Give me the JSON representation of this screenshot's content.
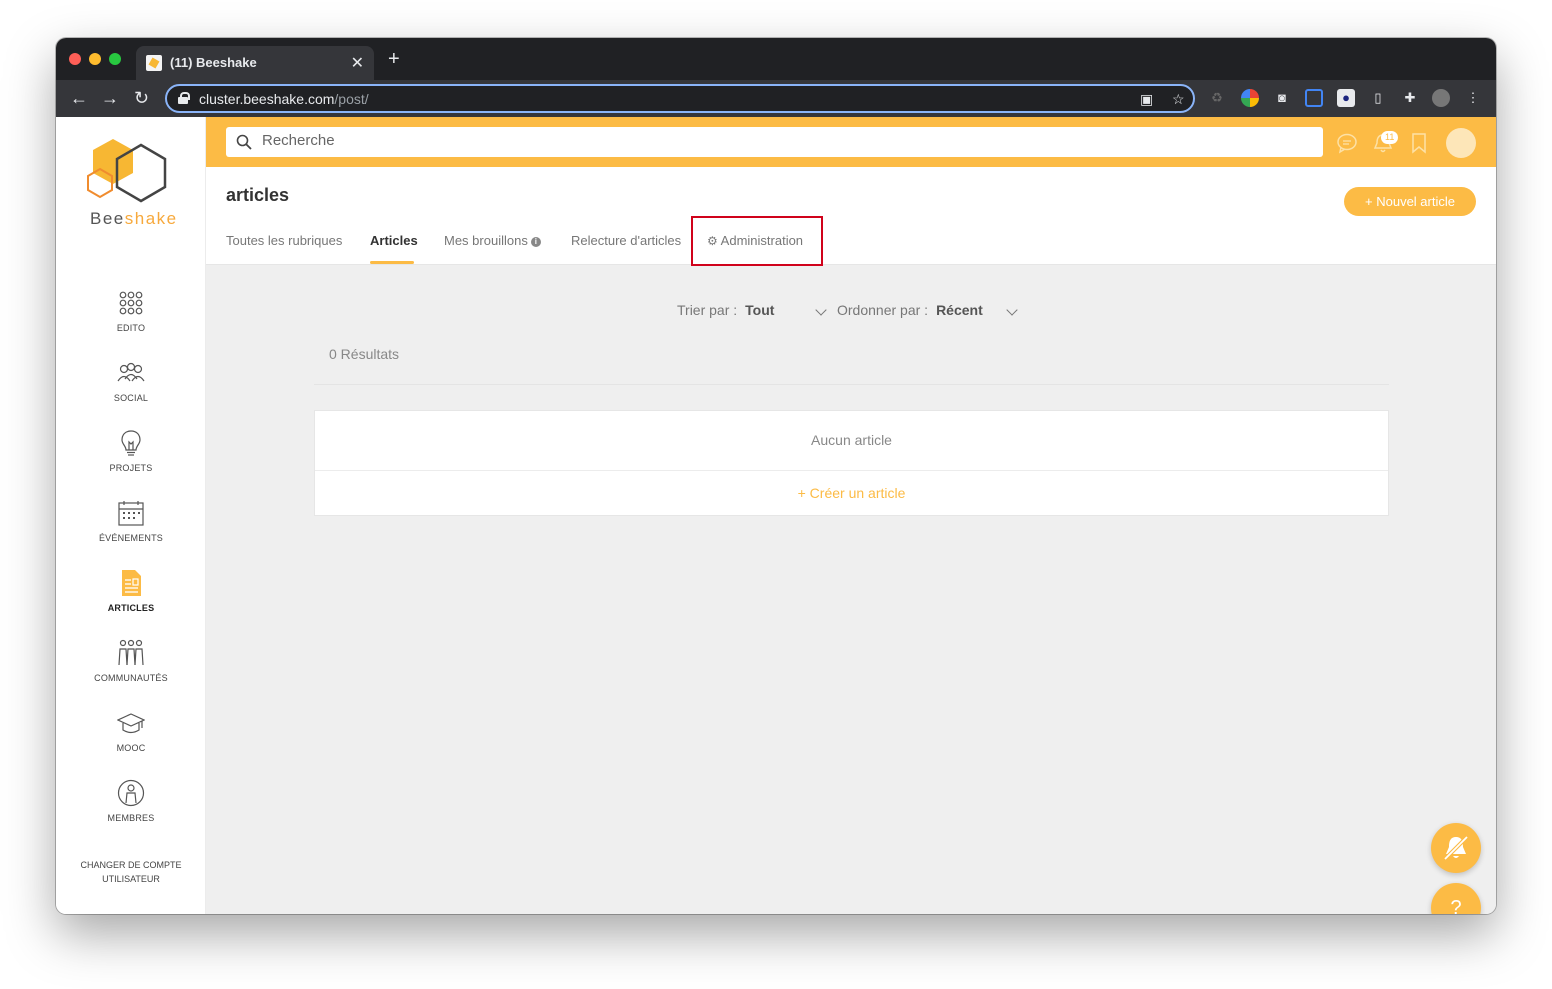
{
  "browser": {
    "tab_title": "(11) Beeshake",
    "tab_close": "✕",
    "new_tab": "+",
    "url_host": "cluster.beeshake.com",
    "url_path": "/post/",
    "back": "←",
    "forward": "→",
    "reload": "↻",
    "menu": "⋮"
  },
  "sidebar": {
    "logo_text_a": "Bee",
    "logo_text_b": "shake",
    "items": [
      {
        "label": "EDITO",
        "icon": "grid-dots-icon"
      },
      {
        "label": "SOCIAL",
        "icon": "people-icon"
      },
      {
        "label": "PROJETS",
        "icon": "lightbulb-icon"
      },
      {
        "label": "ÉVÉNEMENTS",
        "icon": "calendar-icon"
      },
      {
        "label": "ARTICLES",
        "icon": "article-icon",
        "active": true
      },
      {
        "label": "COMMUNAUTÉS",
        "icon": "community-icon"
      },
      {
        "label": "MOOC",
        "icon": "graduation-cap-icon"
      },
      {
        "label": "MEMBRES",
        "icon": "member-icon"
      }
    ],
    "switch_account_line1": "CHANGER DE COMPTE",
    "switch_account_line2": "UTILISATEUR"
  },
  "topbar": {
    "search_placeholder": "Recherche",
    "notification_count": "11"
  },
  "header": {
    "title": "articles",
    "new_article_label": "+ Nouvel article",
    "tabs": [
      {
        "label": "Toutes les rubriques"
      },
      {
        "label": "Articles",
        "active": true
      },
      {
        "label": "Mes brouillons"
      },
      {
        "label": "Relecture d'articles"
      },
      {
        "label": "Administration"
      }
    ]
  },
  "filters": {
    "sort_label": "Trier par :",
    "sort_value": "Tout",
    "order_label": "Ordonner par :",
    "order_value": "Récent"
  },
  "results_text": "0 Résultats",
  "empty": {
    "message": "Aucun article",
    "create_label": "+ Créer un article"
  },
  "help_label": "?",
  "colors": {
    "accent": "#fcbb45",
    "highlight": "#d0021b"
  }
}
